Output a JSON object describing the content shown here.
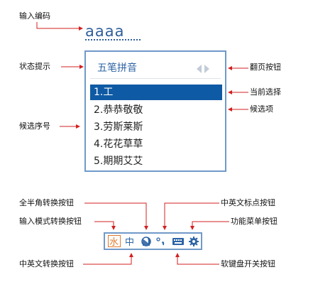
{
  "labels": {
    "input_code": "输入编码",
    "status_hint": "状态提示",
    "page_button": "翻页按钮",
    "current_selection": "当前选择",
    "candidate_item": "候选项",
    "candidate_number": "候选序号",
    "full_half_width_button": "全半角转换按钮",
    "cn_en_punct_button": "中英文标点按钮",
    "input_mode_button": "输入模式转换按钮",
    "function_menu_button": "功能菜单按钮",
    "cn_en_switch_button": "中英文转换按钮",
    "soft_keyboard_button": "软键盘开关按钮"
  },
  "ime": {
    "code": "aaaa",
    "status": "五笔拼音",
    "candidates": [
      "1.工",
      "2.恭恭敬敬",
      "3.劳斯莱斯",
      "4.花花草草",
      "5.期期艾艾"
    ],
    "selected_index": 0
  },
  "toolbar": {
    "icons": [
      "water-icon",
      "cn-en-icon",
      "half-moon-icon",
      "punctuation-icon",
      "keyboard-icon",
      "gear-icon"
    ],
    "water_glyph": "水",
    "cn_glyph": "中",
    "accent": "#e07a2e",
    "blue": "#2e64a5"
  }
}
